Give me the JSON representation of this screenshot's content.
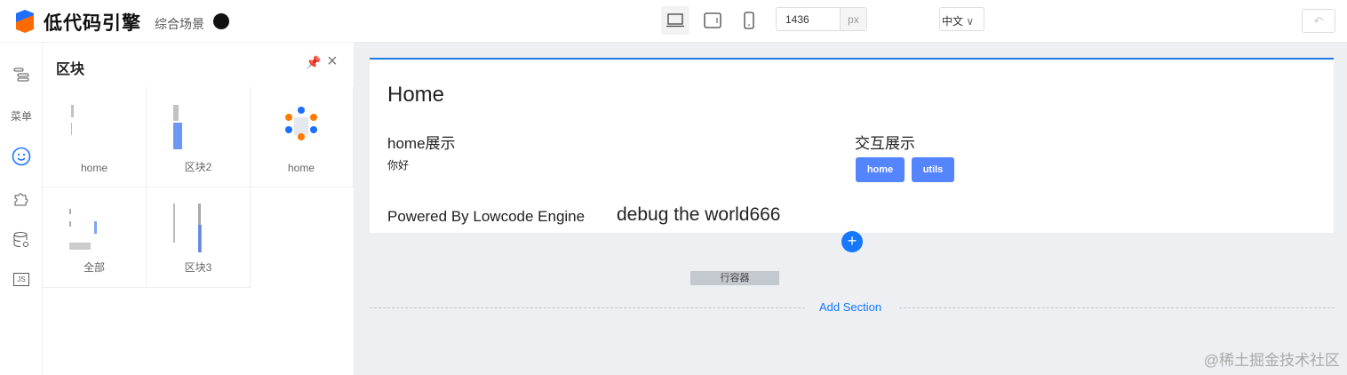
{
  "header": {
    "brand": "低代码引擎",
    "scene": "综合场景",
    "width_value": "1436",
    "width_unit": "px",
    "language": "中文",
    "undo_label": "↶"
  },
  "rail": {
    "menu_label": "菜单",
    "js_label": "JS"
  },
  "panel": {
    "title": "区块",
    "blocks": [
      {
        "label": "home"
      },
      {
        "label": "区块2"
      },
      {
        "label": "home"
      },
      {
        "label": "全部"
      },
      {
        "label": "区块3"
      }
    ]
  },
  "canvas": {
    "title": "Home",
    "section1_title": "home展示",
    "section1_text": "你好",
    "section2_title": "交互展示",
    "buttons": [
      "home",
      "utils"
    ],
    "powered": "Powered By Lowcode Engine",
    "debug": "debug the world666",
    "row_container": "行容器",
    "add_section": "Add Section"
  },
  "watermark": "@稀土掘金技术社区",
  "colors": {
    "accent": "#1677ff",
    "button": "#5584ff",
    "logo_blue": "#1e6fff",
    "logo_orange": "#ff6a00"
  }
}
